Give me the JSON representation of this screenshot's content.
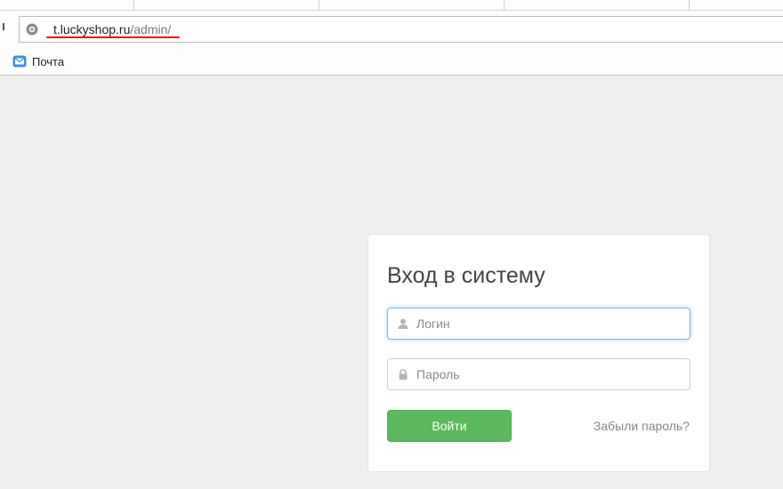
{
  "browser": {
    "url_host": "t.luckyshop.ru",
    "url_path": "/admin/",
    "bookmarks": [
      {
        "label": "Почта",
        "icon": "mail-icon"
      }
    ],
    "underline_color": "#e01515"
  },
  "login": {
    "title": "Вход в систему",
    "username_placeholder": "Логин",
    "password_placeholder": "Пароль",
    "submit_label": "Войти",
    "forgot_label": "Забыли пароль?",
    "accent_color": "#5cb85c"
  }
}
